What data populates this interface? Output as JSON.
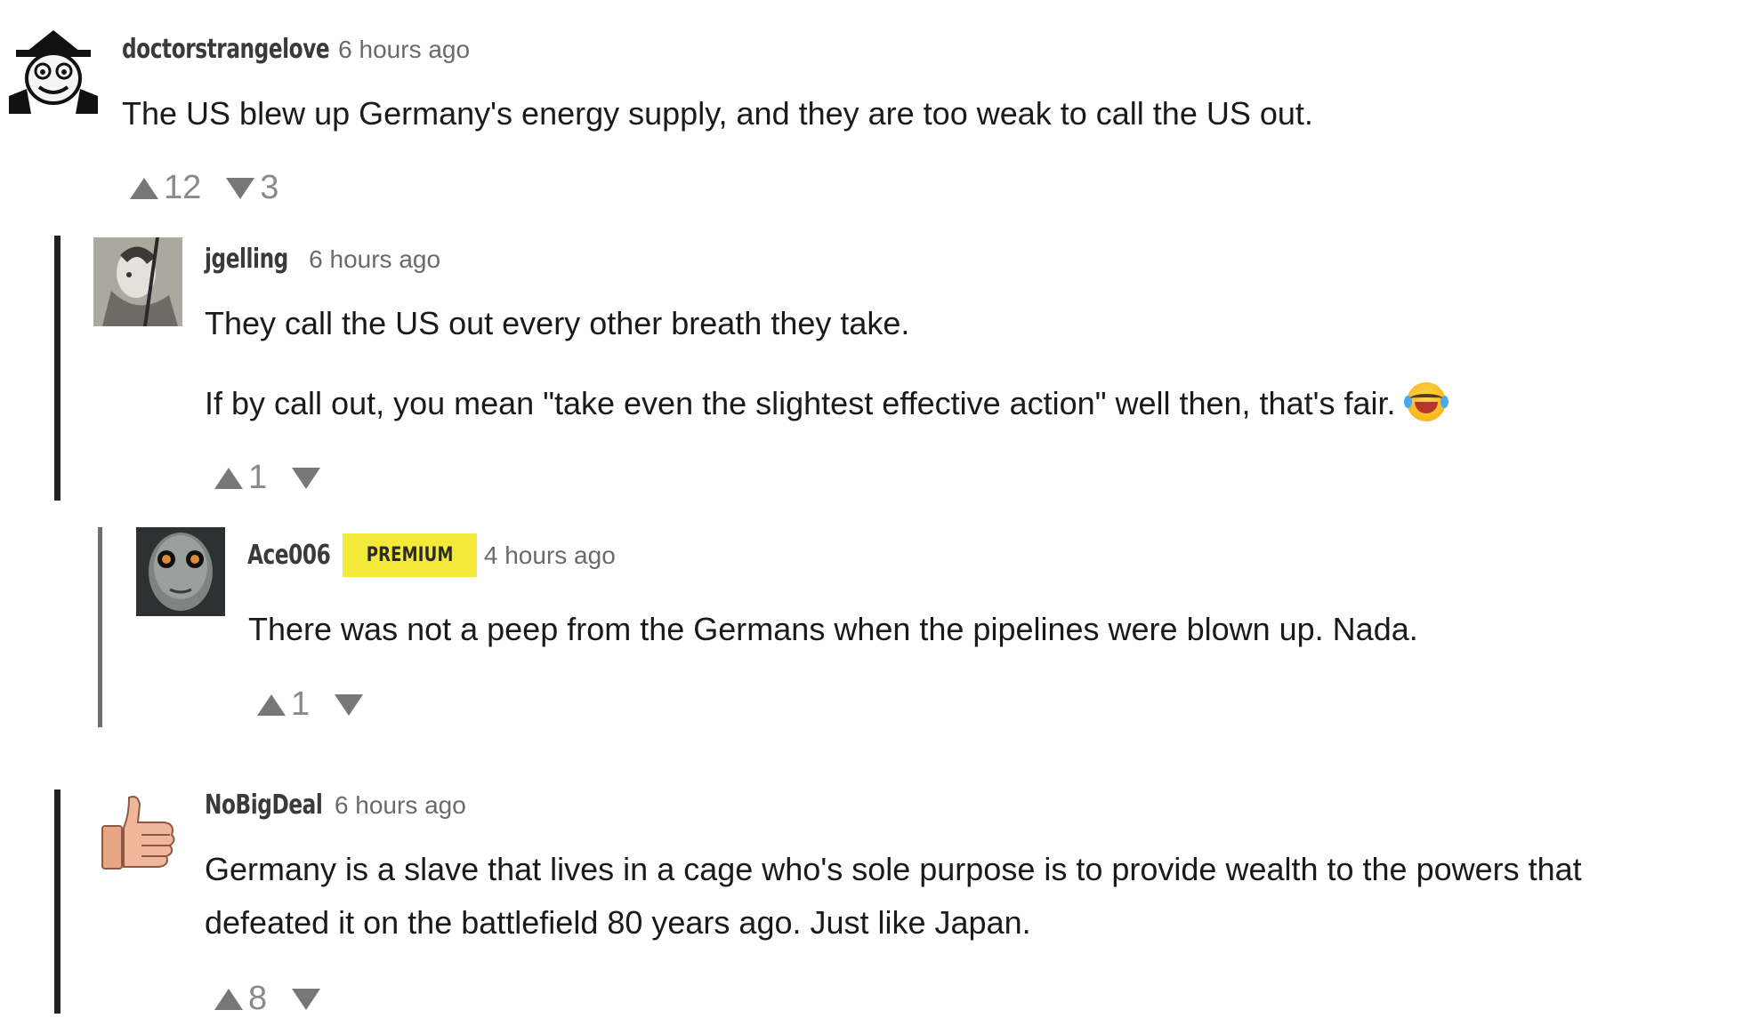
{
  "comments": [
    {
      "username": "doctorstrangelove",
      "timestamp": "6 hours ago",
      "text": "The US blew up Germany's energy supply, and they are too weak to call the US out.",
      "upvotes": "12",
      "downvotes": "3",
      "avatar_icon": "spy-cartoon-avatar"
    },
    {
      "username": "jgelling",
      "timestamp": "6 hours ago",
      "paragraphs": [
        "They call the US out every other breath they take.",
        "If by call out, you mean \"take even the slightest effective action\" well then, that's fair."
      ],
      "emoji_icon": "laughing-crying-emoji",
      "upvotes": "1",
      "downvotes": "",
      "avatar_icon": "statue-avatar"
    },
    {
      "username": "Ace006",
      "badge": "PREMIUM",
      "timestamp": "4 hours ago",
      "text": "There was not a peep from the Germans when the pipelines were blown up.  Nada.",
      "upvotes": "1",
      "downvotes": "",
      "avatar_icon": "dark-goggles-face-avatar"
    },
    {
      "username": "NoBigDeal",
      "timestamp": "6 hours ago",
      "lines": [
        "Germany is a slave that lives in a cage who's sole purpose is to provide wealth to the powers that",
        "defeated it on the battlefield 80 years ago.  Just like Japan."
      ],
      "upvotes": "8",
      "downvotes": "",
      "avatar_icon": "thumbs-up-avatar"
    }
  ],
  "colors": {
    "thread_bar_dark": "#222222",
    "thread_bar_light": "#6f6f6f",
    "premium_badge": "#f3e93b",
    "vote_icon": "#777777"
  }
}
